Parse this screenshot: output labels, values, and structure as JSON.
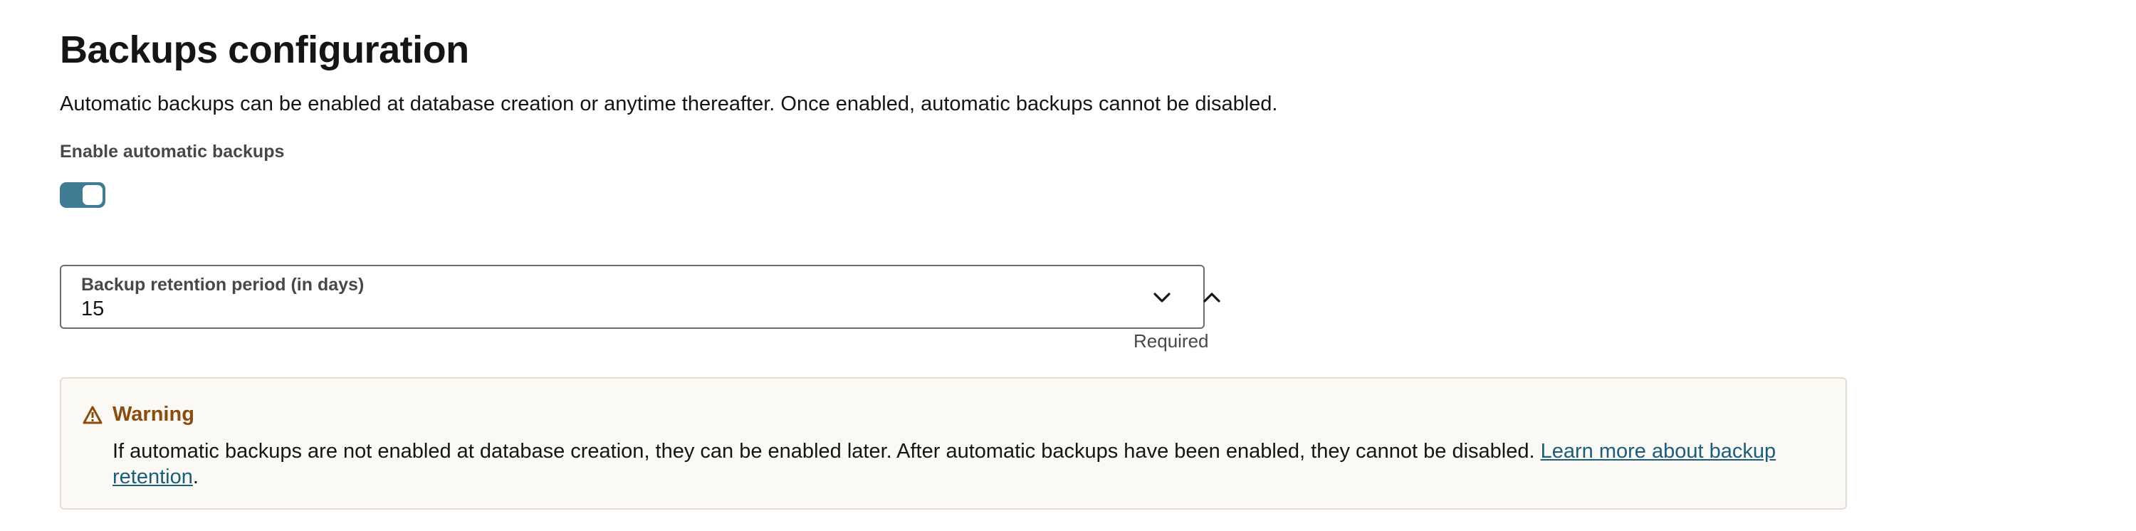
{
  "page": {
    "title": "Backups configuration",
    "description": "Automatic backups can be enabled at database creation or anytime thereafter. Once enabled, automatic backups cannot be disabled."
  },
  "toggle": {
    "label": "Enable automatic backups",
    "checked": true
  },
  "retention_field": {
    "label": "Backup retention period (in days)",
    "value": "15",
    "helper": "Required",
    "decrement_icon": "chevron-down-icon",
    "increment_icon": "chevron-up-icon"
  },
  "warning": {
    "icon": "warning-triangle-icon",
    "title": "Warning",
    "text": "If automatic backups are not enabled at database creation, they can be enabled later. After automatic backups have been enabled, they cannot be disabled. ",
    "link_text": "Learn more about backup retention",
    "suffix": "."
  },
  "colors": {
    "toggle_on": "#3f7c94",
    "warning_title": "#8a4d0f",
    "warning_bg": "#fbf9f4",
    "link": "#1a5d7e"
  }
}
